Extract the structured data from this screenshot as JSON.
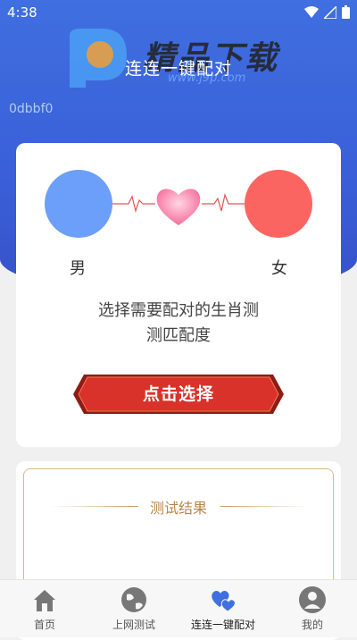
{
  "status_bar": {
    "time": "4:38"
  },
  "header": {
    "title": "连连一键配对",
    "hex_label": "0dbbf0"
  },
  "watermark": {
    "logo_text": "精品下载",
    "site": "www.j9p.com"
  },
  "card": {
    "male_label": "男",
    "female_label": "女",
    "description_line1": "选择需要配对的生肖测",
    "description_line2": "测匹配度",
    "select_button": "点击选择"
  },
  "result": {
    "title": "测试结果"
  },
  "tabs": [
    {
      "label": "首页",
      "icon": "home-icon"
    },
    {
      "label": "上网测试",
      "icon": "globe-icon"
    },
    {
      "label": "连连一键配对",
      "icon": "hearts-icon"
    },
    {
      "label": "我的",
      "icon": "user-icon"
    }
  ],
  "colors": {
    "header_blue": "#3f6fe0",
    "male": "#6b9ffa",
    "female": "#fb6561",
    "button_red": "#d8322a",
    "gold": "#b8864a"
  }
}
